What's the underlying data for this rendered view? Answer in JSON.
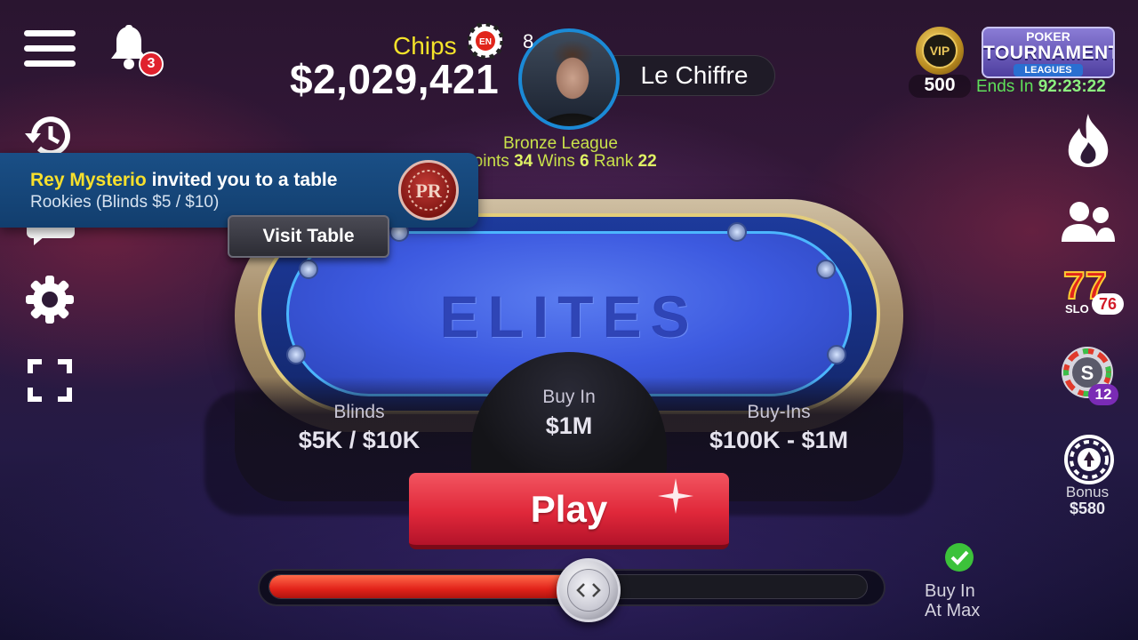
{
  "header": {
    "notifications_count": "3",
    "chips_label": "Chips",
    "chips_value": "$2,029,421",
    "player_level": "8",
    "player_name": "Le Chiffre",
    "league_name": "Bronze League",
    "league_points_label": "Points",
    "league_points": "34",
    "league_wins_label": "Wins",
    "league_wins": "6",
    "league_rank_label": "Rank",
    "league_rank": "22",
    "vip_label": "VIP",
    "vip_points": "500",
    "tournament_logo": {
      "line1": "POKER",
      "line2": "TOURNAMENT",
      "line3": "LEAGUES"
    },
    "tournament_ends_label": "Ends In",
    "tournament_ends_time": "92:23:22"
  },
  "invite": {
    "inviter": "Rey Mysterio",
    "message": "invited you to a table",
    "table_info": "Rookies (Blinds $5 / $10)",
    "visit_label": "Visit Table"
  },
  "table": {
    "name": "ELITES",
    "blinds_label": "Blinds",
    "blinds_value": "$5K / $10K",
    "buyin_label": "Buy In",
    "buyin_value": "$1M",
    "buyins_label": "Buy-Ins",
    "buyins_value": "$100K - $1M"
  },
  "play_label": "Play",
  "slider": {
    "fill_fraction": 0.5
  },
  "buy_in_max_label_1": "Buy In",
  "buy_in_max_label_2": "At Max",
  "right_rail": {
    "slots_count": "76",
    "spin_count": "12",
    "bonus_label": "Bonus",
    "bonus_amount": "$580"
  },
  "icons": [
    "menu-icon",
    "bell-icon",
    "history-icon",
    "chat-icon",
    "gear-icon",
    "fullscreen-icon",
    "fire-icon",
    "friends-icon",
    "slots-icon",
    "spin-wheel-icon",
    "bonus-icon",
    "check-icon"
  ],
  "colors": {
    "accent_yellow": "#f4e32a",
    "league_green": "#c9e14a",
    "play_red": "#e0283a",
    "felt_blue": "#3d5ae0"
  }
}
